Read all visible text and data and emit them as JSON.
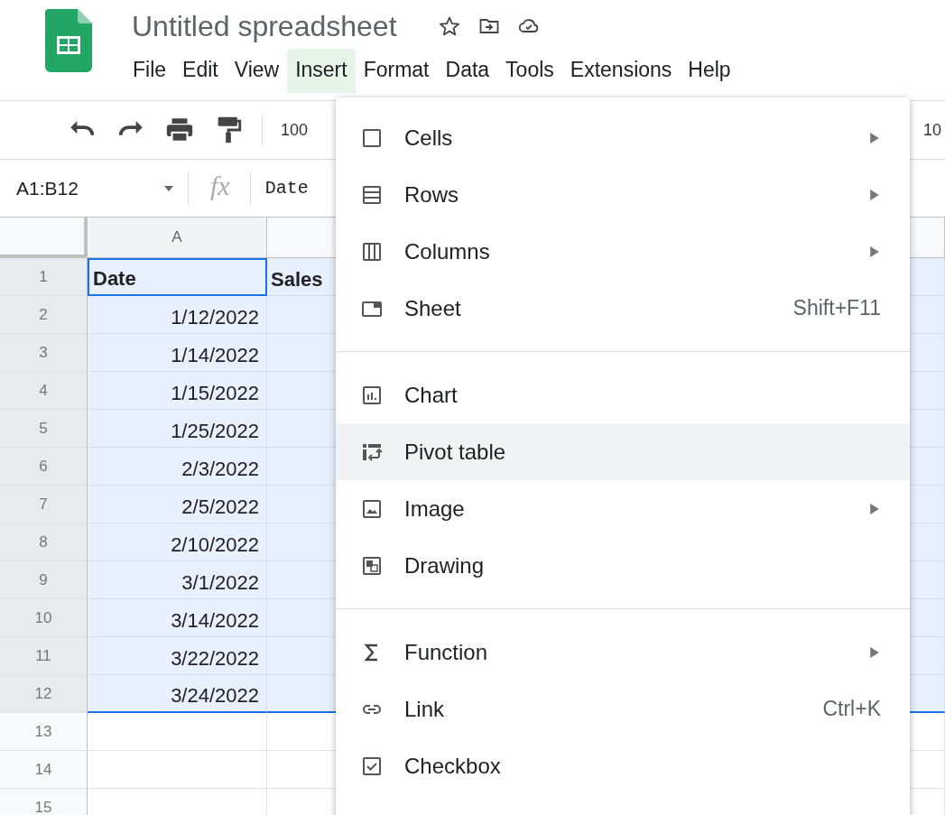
{
  "document": {
    "title": "Untitled spreadsheet"
  },
  "menubar": [
    {
      "label": "File",
      "selected": false
    },
    {
      "label": "Edit",
      "selected": false
    },
    {
      "label": "View",
      "selected": false
    },
    {
      "label": "Insert",
      "selected": true
    },
    {
      "label": "Format",
      "selected": false
    },
    {
      "label": "Data",
      "selected": false
    },
    {
      "label": "Tools",
      "selected": false
    },
    {
      "label": "Extensions",
      "selected": false
    },
    {
      "label": "Help",
      "selected": false
    }
  ],
  "toolbar": {
    "zoom": "100",
    "font_size": "10"
  },
  "formula_bar": {
    "name_box": "A1:B12",
    "function_label": "fx",
    "content": "Date"
  },
  "grid": {
    "columns": [
      "A"
    ],
    "rows": [
      {
        "number": "1",
        "selected": true,
        "cells": [
          {
            "text": "Date",
            "active": true,
            "bold": true
          },
          {
            "text": "Sales",
            "active": false,
            "bold": true
          }
        ]
      },
      {
        "number": "2",
        "selected": true,
        "cells": [
          {
            "text": "1/12/2022",
            "active": false,
            "bold": false
          }
        ]
      },
      {
        "number": "3",
        "selected": true,
        "cells": [
          {
            "text": "1/14/2022",
            "active": false,
            "bold": false
          }
        ]
      },
      {
        "number": "4",
        "selected": true,
        "cells": [
          {
            "text": "1/15/2022",
            "active": false,
            "bold": false
          }
        ]
      },
      {
        "number": "5",
        "selected": true,
        "cells": [
          {
            "text": "1/25/2022",
            "active": false,
            "bold": false
          }
        ]
      },
      {
        "number": "6",
        "selected": true,
        "cells": [
          {
            "text": "2/3/2022",
            "active": false,
            "bold": false
          }
        ]
      },
      {
        "number": "7",
        "selected": true,
        "cells": [
          {
            "text": "2/5/2022",
            "active": false,
            "bold": false
          }
        ]
      },
      {
        "number": "8",
        "selected": true,
        "cells": [
          {
            "text": "2/10/2022",
            "active": false,
            "bold": false
          }
        ]
      },
      {
        "number": "9",
        "selected": true,
        "cells": [
          {
            "text": "3/1/2022",
            "active": false,
            "bold": false
          }
        ]
      },
      {
        "number": "10",
        "selected": true,
        "cells": [
          {
            "text": "3/14/2022",
            "active": false,
            "bold": false
          }
        ]
      },
      {
        "number": "11",
        "selected": true,
        "cells": [
          {
            "text": "3/22/2022",
            "active": false,
            "bold": false
          }
        ]
      },
      {
        "number": "12",
        "selected": true,
        "cells": [
          {
            "text": "3/24/2022",
            "active": false,
            "bold": false
          }
        ]
      },
      {
        "number": "13",
        "selected": false,
        "cells": []
      },
      {
        "number": "14",
        "selected": false,
        "cells": []
      },
      {
        "number": "15",
        "selected": false,
        "cells": []
      }
    ]
  },
  "insert_menu": {
    "sections": [
      [
        {
          "label": "Cells",
          "submenu": true,
          "selected": false
        },
        {
          "label": "Rows",
          "submenu": true,
          "selected": false
        },
        {
          "label": "Columns",
          "submenu": true,
          "selected": false
        },
        {
          "label": "Sheet",
          "shortcut": "Shift+F11",
          "submenu": false,
          "selected": false
        }
      ],
      [
        {
          "label": "Chart",
          "submenu": false,
          "selected": false
        },
        {
          "label": "Pivot table",
          "submenu": false,
          "selected": true
        },
        {
          "label": "Image",
          "submenu": true,
          "selected": false
        },
        {
          "label": "Drawing",
          "submenu": false,
          "selected": false
        }
      ],
      [
        {
          "label": "Function",
          "submenu": true,
          "selected": false
        },
        {
          "label": "Link",
          "shortcut": "Ctrl+K",
          "submenu": false,
          "selected": false
        },
        {
          "label": "Checkbox",
          "submenu": false,
          "selected": false
        }
      ]
    ]
  }
}
